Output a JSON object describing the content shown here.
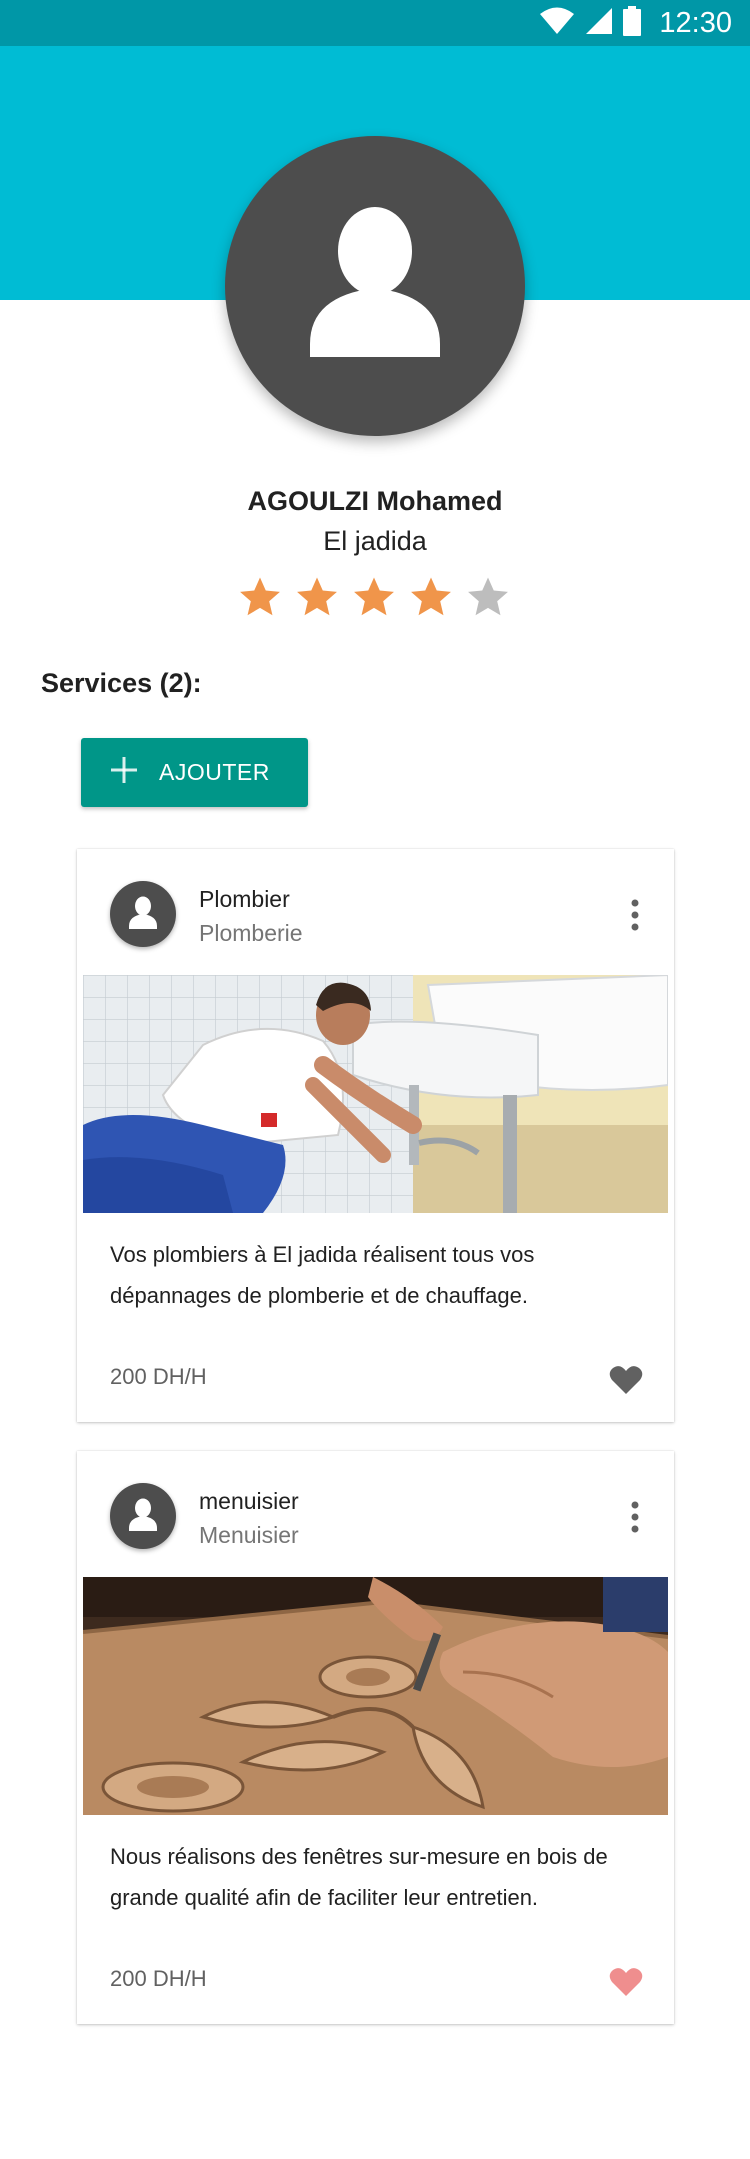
{
  "status_bar": {
    "time": "12:30",
    "icons": [
      "wifi-icon",
      "signal-icon",
      "battery-icon"
    ]
  },
  "colors": {
    "status_bar": "#0097a7",
    "header": "#00bcd4",
    "accent_button": "#009688",
    "star_filled": "#f0954a",
    "star_empty": "#bdbdbd",
    "favorite_active": "#ef8e8e",
    "favorite_inactive": "#616161"
  },
  "profile": {
    "name": "AGOULZI Mohamed",
    "city": "El jadida",
    "rating": 4,
    "rating_max": 5
  },
  "services": {
    "title": "Services (2):",
    "add_button": "AJOUTER",
    "items": [
      {
        "title": "Plombier",
        "subtitle": "Plomberie",
        "description": "Vos plombiers à El jadida réalisent tous vos dépannages de plomberie et de chauffage.",
        "price": "200 DH/H",
        "favorite": false
      },
      {
        "title": "menuisier",
        "subtitle": "Menuisier",
        "description": "Nous réalisons des fenêtres sur-mesure en bois de grande qualité afin de faciliter leur entretien.",
        "price": "200 DH/H",
        "favorite": true
      }
    ]
  }
}
